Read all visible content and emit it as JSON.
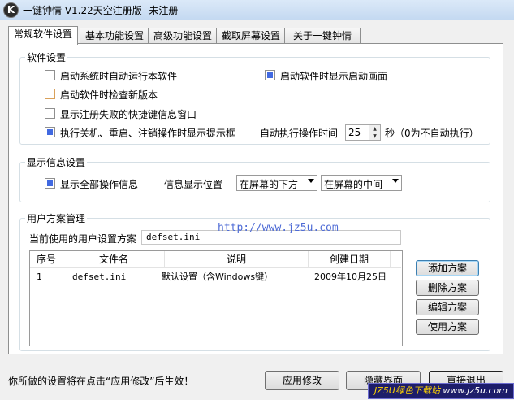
{
  "window": {
    "title": "一键钟情 V1.22天空注册版--未注册",
    "icon": "K"
  },
  "tabs": [
    "常规软件设置",
    "基本功能设置",
    "高级功能设置",
    "截取屏幕设置",
    "关于一键钟情"
  ],
  "software": {
    "label": "软件设置",
    "autostart": "启动系统时自动运行本软件",
    "splash": "启动软件时显示启动画面",
    "check_update": "启动软件时检查新版本",
    "hotkey_fail": "显示注册失败的快捷键信息窗口",
    "shutdown_prompt": "执行关机、重启、注销操作时显示提示框",
    "auto_time_label": "自动执行操作时间",
    "auto_time_value": "25",
    "auto_time_unit": "秒（0为不自动执行）"
  },
  "display": {
    "label": "显示信息设置",
    "show_all": "显示全部操作信息",
    "position_label": "信息显示位置",
    "vertical": "在屏幕的下方",
    "horizontal": "在屏幕的中间"
  },
  "plans": {
    "label": "用户方案管理",
    "current_label": "当前使用的用户设置方案",
    "current_value": "defset.ini",
    "watermark": "http://www.jz5u.com",
    "columns": [
      "序号",
      "文件名",
      "说明",
      "创建日期"
    ],
    "rows": [
      {
        "no": "1",
        "file": "defset.ini",
        "desc": "默认设置（含Windows键）",
        "date": "2009年10月25日"
      }
    ],
    "buttons": {
      "add": "添加方案",
      "delete": "删除方案",
      "edit": "编辑方案",
      "use": "使用方案"
    }
  },
  "footer": {
    "status": "你所做的设置将在点击“应用修改”后生效！",
    "apply": "应用修改",
    "hide": "隐藏界面",
    "exit": "直接退出"
  },
  "badge": {
    "brand": "JZ5U绿色下载站",
    "site": "www.jz5u.com"
  }
}
